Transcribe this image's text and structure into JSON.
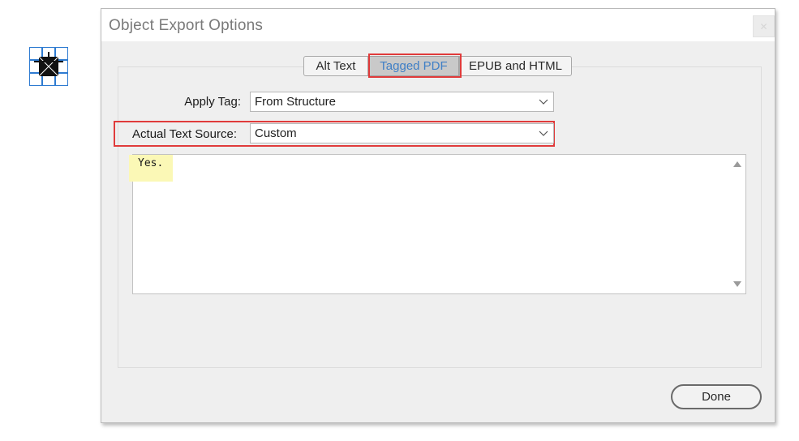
{
  "dialog": {
    "title": "Object Export Options",
    "close_icon": "close-icon"
  },
  "tabs": [
    {
      "label": "Alt Text"
    },
    {
      "label": "Tagged PDF",
      "selected": true
    },
    {
      "label": "EPUB and HTML"
    }
  ],
  "form": {
    "apply_tag_label": "Apply Tag:",
    "apply_tag_value": "From Structure",
    "actual_text_source_label": "Actual Text Source:",
    "actual_text_source_value": "Custom"
  },
  "custom_text": {
    "value": "Yes."
  },
  "buttons": {
    "done_label": "Done"
  },
  "colors": {
    "highlight_red": "#e03b3b",
    "selected_tab_text": "#3f7fc6",
    "text_highlight": "#fbf8b6"
  }
}
